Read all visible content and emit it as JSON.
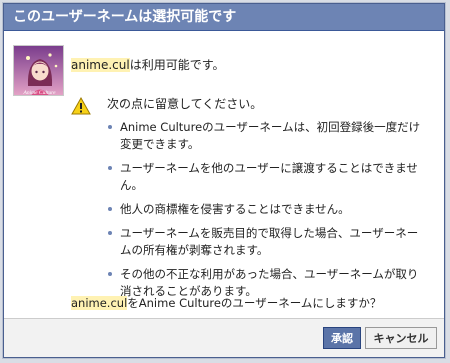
{
  "dialog": {
    "title": "このユーザーネームは選択可能です",
    "username": "anime.cul",
    "availability_suffix": "は利用可能です。",
    "avatar_text": "Anime Culture",
    "notice_title": "次の点に留意してください。",
    "bullets": [
      "Anime Cultureのユーザーネームは、初回登録後一度だけ変更できます。",
      "ユーザーネームを他のユーザーに譲渡することはできません。",
      "他人の商標権を侵害することはできません。",
      "ユーザーネームを販売目的で取得した場合、ユーザーネームの所有権が剥奪されます。",
      "その他の不正な利用があった場合、ユーザーネームが取り消されることがあります。"
    ],
    "question_suffix": "をAnime Cultureのユーザーネームにしますか？",
    "confirm_label": "承認",
    "cancel_label": "キャンセル"
  },
  "colors": {
    "titlebar": "#6d84b4",
    "highlight": "#fff2b3",
    "primary_button": "#5b74a8",
    "warning": "#f7d117"
  },
  "icons": {
    "avatar": "anime-character-avatar",
    "warning": "warning-icon"
  }
}
